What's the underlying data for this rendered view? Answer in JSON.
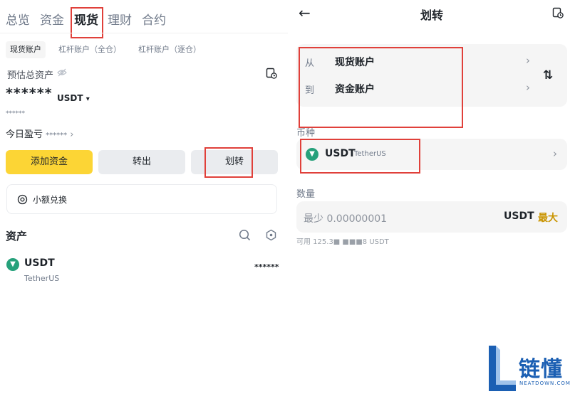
{
  "left": {
    "top_tabs": [
      "总览",
      "资金",
      "现货",
      "理财",
      "合约"
    ],
    "sub_tabs": [
      "现货账户",
      "杠杆账户（全仓）",
      "杠杆账户（逐仓）"
    ],
    "est_label": "预估总资产",
    "balance_masked": "******",
    "currency": "USDT",
    "currency_caret": "▾",
    "small_masked": "******",
    "pnl_label": "今日盈亏",
    "pnl_masked": "******",
    "buttons": {
      "deposit": "添加资金",
      "withdraw": "转出",
      "transfer": "划转"
    },
    "convert_label": "小额兑换",
    "assets_heading": "资产",
    "asset": {
      "symbol": "USDT",
      "name": "TetherUS",
      "amount_masked": "******"
    }
  },
  "right": {
    "back_icon": "←",
    "title": "划转",
    "from_label": "从",
    "from_account": "现货账户",
    "to_label": "到",
    "to_account": "资金账户",
    "swap_icon": "⇅",
    "coin_section_label": "币种",
    "coin_symbol": "USDT",
    "coin_name": "TetherUS",
    "amount_section_label": "数量",
    "amount_placeholder": "最少 0.00000001",
    "amount_unit": "USDT",
    "max_label": "最大",
    "available_text": "可用 125.3■ ■■■8 USDT"
  },
  "watermark": {
    "brand": "链懂",
    "domain": "NEATDOWN.COM"
  },
  "colors": {
    "accent_yellow": "#fcd535",
    "max_text": "#c99400",
    "highlight_red": "#e0403a",
    "tether_green": "#26a17b"
  }
}
